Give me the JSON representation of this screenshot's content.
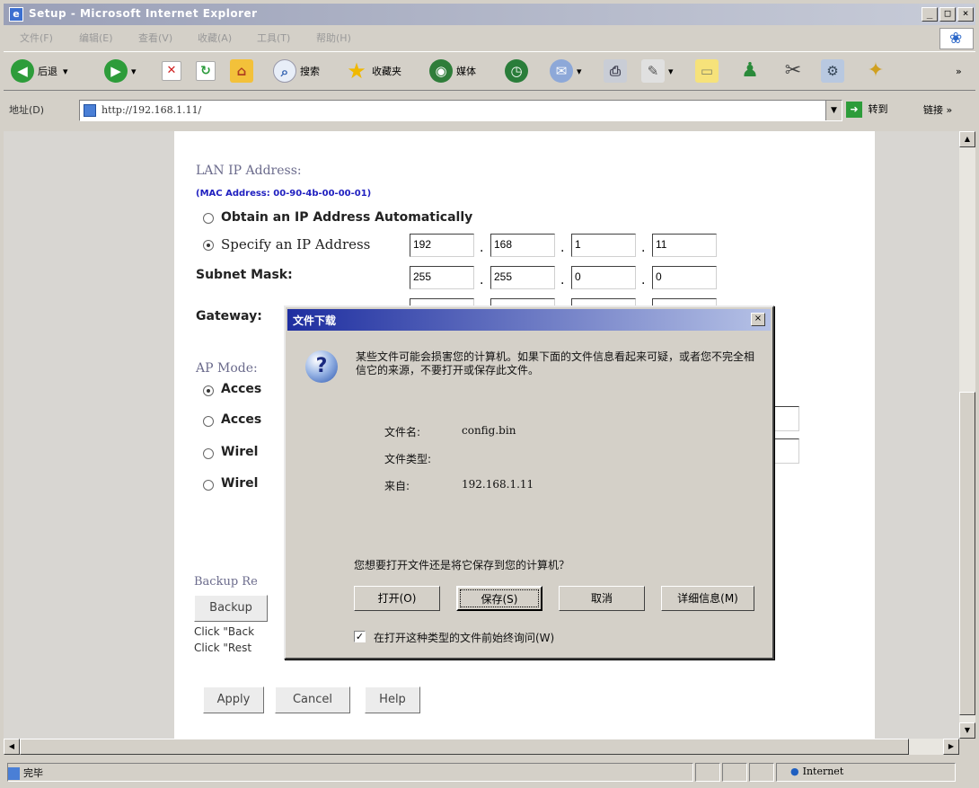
{
  "window": {
    "title": "Setup - Microsoft Internet Explorer",
    "min": "_",
    "max": "□",
    "close": "×"
  },
  "menu": [
    "文件(F)",
    "编辑(E)",
    "查看(V)",
    "收藏(A)",
    "工具(T)",
    "帮助(H)"
  ],
  "toolbar": {
    "back": "后退",
    "search": "搜索",
    "favorites": "收藏夹",
    "media": "媒体",
    "more": "»"
  },
  "address": {
    "label": "地址(D)",
    "url": "http://192.168.1.11/",
    "go": "转到",
    "links": "链接 »"
  },
  "page": {
    "lan_title": "LAN IP Address:",
    "mac": "(MAC Address: 00-90-4b-00-00-01)",
    "obtain_auto": "Obtain an IP Address Automatically",
    "specify": "Specify an IP Address",
    "ip": [
      "192",
      "168",
      "1",
      "11"
    ],
    "subnet_label": "Subnet Mask:",
    "subnet": [
      "255",
      "255",
      "0",
      "0"
    ],
    "gateway_label": "Gateway:",
    "ap_mode_label": "AP Mode:",
    "ap_options": [
      "Acces",
      "Acces",
      "Wirel",
      "Wirel"
    ],
    "backup_label": "Backup Re",
    "backup_btn": "Backup",
    "click_backup": "Click \"Back",
    "click_restore": "Click \"Rest",
    "apply": "Apply",
    "cancel": "Cancel",
    "help": "Help"
  },
  "dialog": {
    "title": "文件下载",
    "message": "某些文件可能会损害您的计算机。如果下面的文件信息看起来可疑，或者您不完全相信它的来源，不要打开或保存此文件。",
    "filename_label": "文件名:",
    "filename": "config.bin",
    "filetype_label": "文件类型:",
    "filetype": "",
    "from_label": "来自:",
    "from": "192.168.1.11",
    "question": "您想要打开文件还是将它保存到您的计算机？",
    "open": "打开(O)",
    "save": "保存(S)",
    "cancel": "取消",
    "details": "详细信息(M)",
    "always_ask": "在打开这种类型的文件前始终询问(W)",
    "always_ask_checked": true
  },
  "status": {
    "text": "完毕",
    "zone": "Internet"
  }
}
